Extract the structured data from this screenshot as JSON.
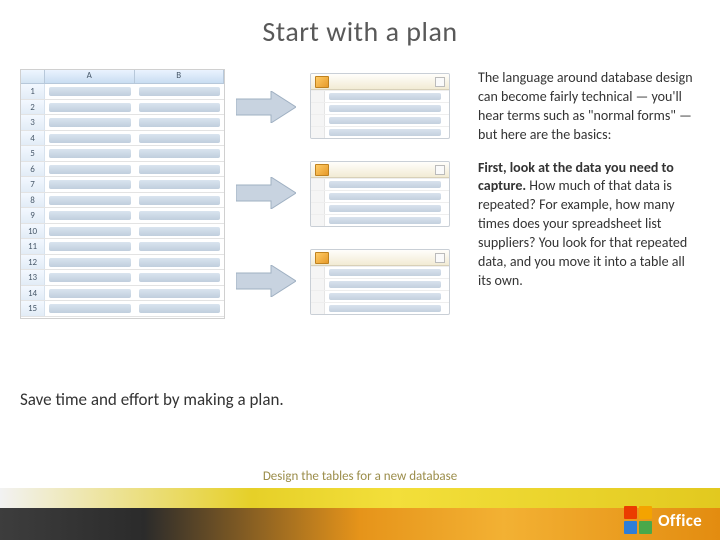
{
  "title": "Start with a plan",
  "paragraphs": {
    "p1": "The language around database design can become fairly technical — you'll hear terms such as \"normal forms\" — but here are the basics:",
    "p2_bold": "First, look at the data you need to capture.",
    "p2_rest": " How much of that data is repeated? For example, how many times does your spreadsheet list suppliers? You look for that repeated data, and you move it into a table all its own."
  },
  "caption": "Save time and effort by making a plan.",
  "footer": "Design the tables for a new database",
  "spreadsheet": {
    "columns": [
      "A",
      "B"
    ],
    "rows": [
      "1",
      "2",
      "3",
      "4",
      "5",
      "6",
      "7",
      "8",
      "9",
      "10",
      "11",
      "12",
      "13",
      "14",
      "15"
    ]
  },
  "brand": "Office"
}
